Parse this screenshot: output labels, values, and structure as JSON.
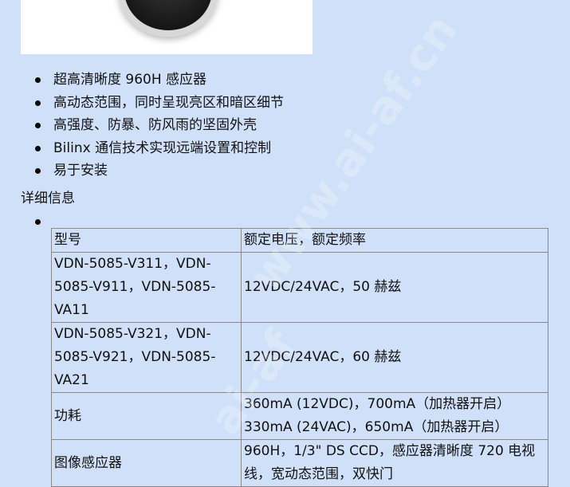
{
  "product_image": {
    "icon": "camera-dome-image"
  },
  "features": [
    "超高清晰度 960H 感应器",
    "高动态范围，同时呈现亮区和暗区细节",
    "高强度、防暴、防风雨的坚固外壳",
    "Bilinx 通信技术实现远端设置和控制",
    "易于安装"
  ],
  "details_title": "详细信息",
  "spec_table": {
    "header": [
      "型号",
      "额定电压，额定频率"
    ],
    "rows": [
      {
        "c1": "VDN-5085-V311，VDN-5085-V911，VDN-5085-VA11",
        "c2": "12VDC/24VAC，50 赫兹"
      },
      {
        "c1": "VDN-5085-V321，VDN-5085-V921，VDN-5085-VA21",
        "c2": "12VDC/24VAC，60 赫兹"
      },
      {
        "c1": "功耗",
        "c2_lines": [
          "360mA (12VDC)，700mA（加热器开启）",
          "330mA (24VAC)，650mA（加热器开启）"
        ]
      },
      {
        "c1": "图像感应器",
        "c2": "960H，1/3\" DS CCD，感应器清晰度 720 电视线，宽动态范围，双快门"
      }
    ]
  },
  "watermark": {
    "text1": "www.ai-af.cn",
    "text2": "ai-af"
  }
}
